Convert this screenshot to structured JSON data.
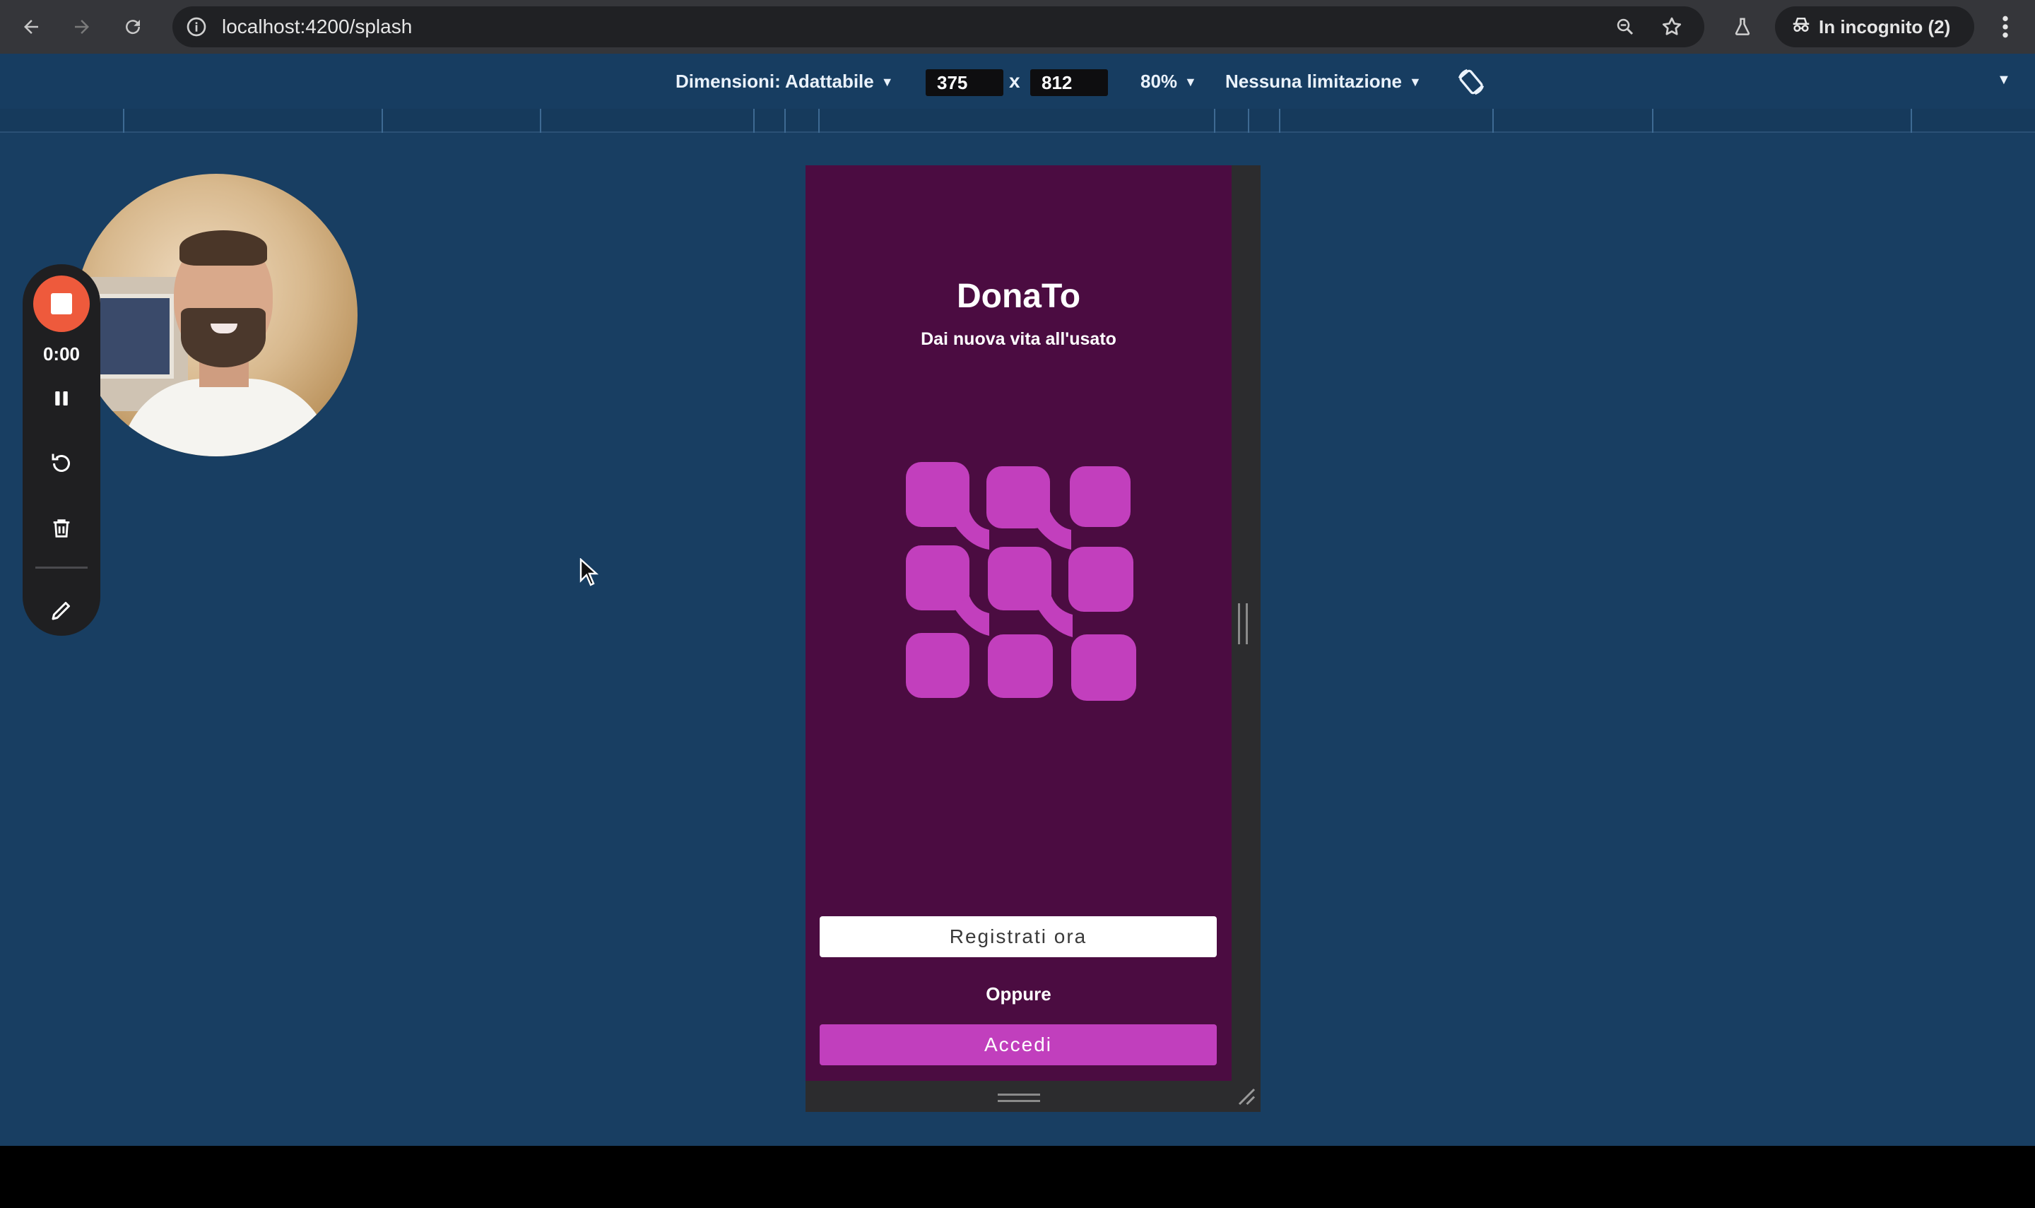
{
  "browser": {
    "url": "localhost:4200/splash",
    "incognito_label": "In incognito (2)"
  },
  "device_toolbar": {
    "dimensions_label": "Dimensioni: Adattabile",
    "width": "375",
    "times": "x",
    "height": "812",
    "zoom": "80%",
    "throttling": "Nessuna limitazione"
  },
  "recorder": {
    "time": "0:00"
  },
  "app": {
    "title": "DonaTo",
    "subtitle": "Dai nuova vita all'usato",
    "register_button": "Registrati ora",
    "or_text": "Oppure",
    "login_button": "Accedi",
    "colors": {
      "background": "#4b0c41",
      "accent": "#c13fbd",
      "canvas": "#183e62"
    }
  }
}
